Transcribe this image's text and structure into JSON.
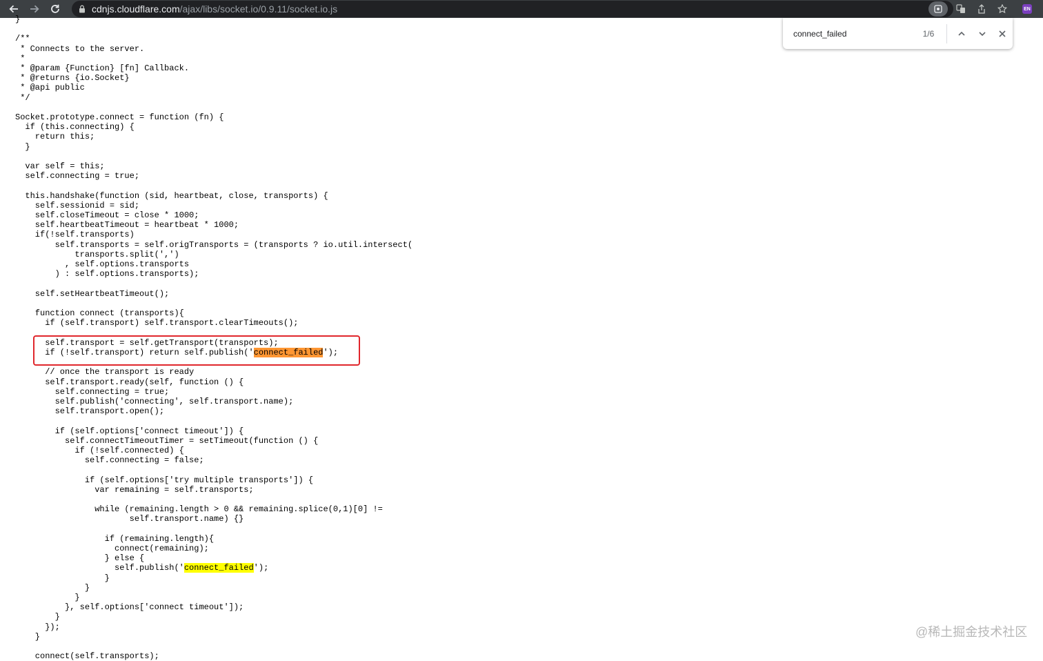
{
  "browser": {
    "url_host": "cdnjs.cloudflare.com",
    "url_path": "/ajax/libs/socket.io/0.9.11/socket.io.js",
    "extension_badge": "EN",
    "icons": [
      "back-arrow-icon",
      "forward-arrow-icon",
      "reload-icon",
      "lock-icon",
      "google-lens-icon",
      "translate-icon",
      "share-icon",
      "bookmark-star-icon",
      "extension-icon"
    ]
  },
  "find_bar": {
    "query": "connect_failed",
    "match_count": "1/6",
    "icons": [
      "chevron-up-icon",
      "chevron-down-icon",
      "close-icon"
    ]
  },
  "code": {
    "block1": "}\n\n/**\n * Connects to the server.\n *\n * @param {Function} [fn] Callback.\n * @returns {io.Socket}\n * @api public\n */\n\nSocket.prototype.connect = function (fn) {\n  if (this.connecting) {\n    return this;\n  }\n\n  var self = this;\n  self.connecting = true;\n\n  this.handshake(function (sid, heartbeat, close, transports) {\n    self.sessionid = sid;\n    self.closeTimeout = close * 1000;\n    self.heartbeatTimeout = heartbeat * 1000;\n    if(!self.transports)\n        self.transports = self.origTransports = (transports ? io.util.intersect(\n            transports.split(',')\n          , self.options.transports\n        ) : self.options.transports);\n\n    self.setHeartbeatTimeout();\n\n    function connect (transports){\n      if (self.transport) self.transport.clearTimeouts();\n\n      self.transport = self.getTransport(transports);\n      if (!self.transport) return self.publish('",
    "match1": "connect_failed",
    "block2": "');\n\n      // once the transport is ready\n      self.transport.ready(self, function () {\n        self.connecting = true;\n        self.publish('connecting', self.transport.name);\n        self.transport.open();\n\n        if (self.options['connect timeout']) {\n          self.connectTimeoutTimer = setTimeout(function () {\n            if (!self.connected) {\n              self.connecting = false;\n\n              if (self.options['try multiple transports']) {\n                var remaining = self.transports;\n\n                while (remaining.length > 0 && remaining.splice(0,1)[0] !=\n                       self.transport.name) {}\n\n                  if (remaining.length){\n                    connect(remaining);\n                  } else {\n                    self.publish('",
    "match2": "connect_failed",
    "block3": "');\n                  }\n              }\n            }\n          }, self.options['connect timeout']);\n        }\n      });\n    }\n\n    connect(self.transports);"
  },
  "watermark": "@稀土掘金技术社区"
}
